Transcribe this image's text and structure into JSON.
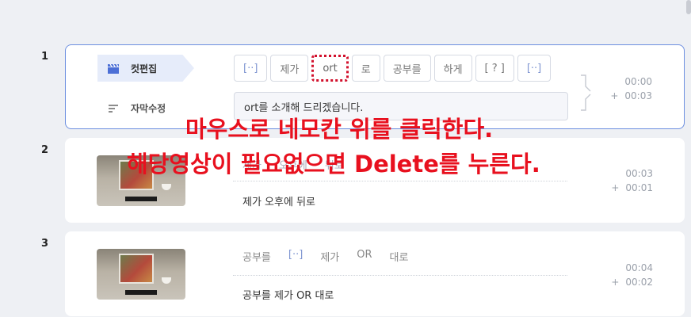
{
  "rows": [
    {
      "number": "1",
      "modes": {
        "cut_edit": "컷편집",
        "subtitle_edit": "자막수정"
      },
      "tokens": [
        {
          "text": "[··]",
          "kind": "bracket"
        },
        {
          "text": "제가",
          "kind": "word"
        },
        {
          "text": "ort",
          "kind": "highlight"
        },
        {
          "text": "로",
          "kind": "word"
        },
        {
          "text": "공부를",
          "kind": "word"
        },
        {
          "text": "하게",
          "kind": "word"
        },
        {
          "text": "[ ? ]",
          "kind": "word"
        },
        {
          "text": "[··]",
          "kind": "bracket"
        }
      ],
      "subtitle": "ort를 소개해 드리겠습니다.",
      "time_start": "00:00",
      "time_duration": "00:03"
    },
    {
      "number": "2",
      "words_visible": [
        "제가",
        "오후에",
        "뒤로"
      ],
      "subtitle": "제가 오후에 뒤로",
      "time_start": "00:03",
      "time_duration": "00:01"
    },
    {
      "number": "3",
      "words": [
        {
          "text": "공부를",
          "kind": "word"
        },
        {
          "text": "[··]",
          "kind": "bracket"
        },
        {
          "text": "제가",
          "kind": "word"
        },
        {
          "text": "OR",
          "kind": "word"
        },
        {
          "text": "대로",
          "kind": "word"
        }
      ],
      "subtitle": "공부를 제가 OR 대로",
      "time_start": "00:04",
      "time_duration": "00:02"
    }
  ],
  "plus_sign": "+",
  "annotation": {
    "line1": "마우스로 네모칸 위를 클릭한다.",
    "line2": "해당영상이 필요없으면 Delete를 누른다."
  },
  "colors": {
    "selection_border": "#6d8fe0",
    "bracket_text": "#7f95d1",
    "annotation": "#e8101e"
  }
}
